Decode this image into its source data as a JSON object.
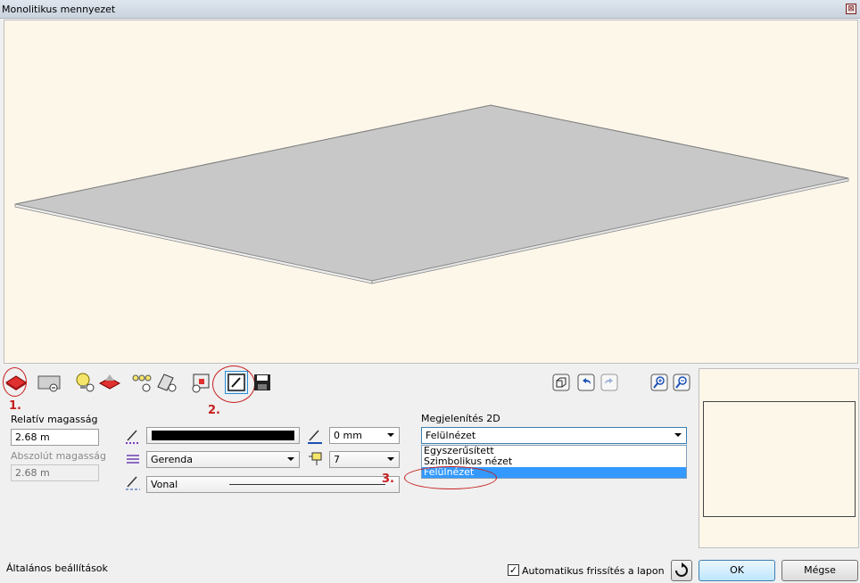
{
  "window": {
    "title": "Monolitikus mennyezet",
    "close_glyph": "⊠"
  },
  "annotations": {
    "step1": "1.",
    "step2": "2.",
    "step3": "3."
  },
  "left_panel": {
    "relative_height_label": "Relatív magasság",
    "relative_height_value": "2.68 m",
    "absolute_height_label": "Abszolút magasság",
    "absolute_height_value": "2.68 m"
  },
  "line_settings": {
    "pen_width_value": "0 mm",
    "layer_value": "Gerenda",
    "pen_number_value": "7",
    "line_type_value": "Vonal"
  },
  "display_2d": {
    "label": "Megjelenítés 2D",
    "selected": "Felülnézet",
    "options": [
      "Egyszerűsített",
      "Szimbolikus nézet",
      "Felülnézet"
    ]
  },
  "footer": {
    "general_settings": "Általános beállítások",
    "auto_refresh_label": "Automatikus frissítés a lapon",
    "auto_refresh_checked": "✓",
    "ok_label": "OK",
    "cancel_label": "Mégse"
  },
  "colors": {
    "accent_red": "#c61e1e",
    "selection_blue": "#3399ff",
    "viewport_bg": "#fdf7ea",
    "slab_fill": "#c8c8c8"
  }
}
